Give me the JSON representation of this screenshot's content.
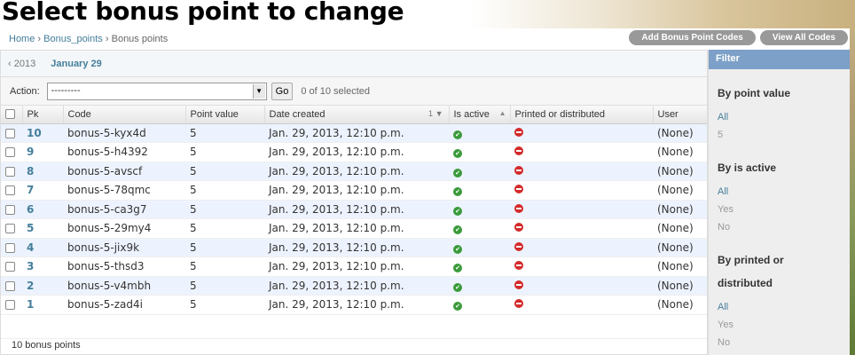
{
  "page": {
    "title": "Select bonus point to change"
  },
  "breadcrumb": {
    "home": "Home",
    "app": "Bonus_points",
    "current": "Bonus points",
    "sep": "›"
  },
  "tools": {
    "add": "Add Bonus Point Codes",
    "view_all": "View All Codes"
  },
  "date_hierarchy": {
    "prev": "‹ 2013",
    "current": "January 29"
  },
  "actions": {
    "label": "Action:",
    "select_value": "---------",
    "go": "Go",
    "selected_count": "0 of 10 selected"
  },
  "table": {
    "columns": [
      "Pk",
      "Code",
      "Point value",
      "Date created",
      "Is active",
      "Printed or distributed",
      "User"
    ],
    "sort_index": "1",
    "rows": [
      {
        "pk": "10",
        "code": "bonus-5-kyx4d",
        "point_value": "5",
        "date": "Jan. 29, 2013, 12:10 p.m.",
        "active": true,
        "printed": false,
        "user": "(None)"
      },
      {
        "pk": "9",
        "code": "bonus-5-h4392",
        "point_value": "5",
        "date": "Jan. 29, 2013, 12:10 p.m.",
        "active": true,
        "printed": false,
        "user": "(None)"
      },
      {
        "pk": "8",
        "code": "bonus-5-avscf",
        "point_value": "5",
        "date": "Jan. 29, 2013, 12:10 p.m.",
        "active": true,
        "printed": false,
        "user": "(None)"
      },
      {
        "pk": "7",
        "code": "bonus-5-78qmc",
        "point_value": "5",
        "date": "Jan. 29, 2013, 12:10 p.m.",
        "active": true,
        "printed": false,
        "user": "(None)"
      },
      {
        "pk": "6",
        "code": "bonus-5-ca3g7",
        "point_value": "5",
        "date": "Jan. 29, 2013, 12:10 p.m.",
        "active": true,
        "printed": false,
        "user": "(None)"
      },
      {
        "pk": "5",
        "code": "bonus-5-29my4",
        "point_value": "5",
        "date": "Jan. 29, 2013, 12:10 p.m.",
        "active": true,
        "printed": false,
        "user": "(None)"
      },
      {
        "pk": "4",
        "code": "bonus-5-jix9k",
        "point_value": "5",
        "date": "Jan. 29, 2013, 12:10 p.m.",
        "active": true,
        "printed": false,
        "user": "(None)"
      },
      {
        "pk": "3",
        "code": "bonus-5-thsd3",
        "point_value": "5",
        "date": "Jan. 29, 2013, 12:10 p.m.",
        "active": true,
        "printed": false,
        "user": "(None)"
      },
      {
        "pk": "2",
        "code": "bonus-5-v4mbh",
        "point_value": "5",
        "date": "Jan. 29, 2013, 12:10 p.m.",
        "active": true,
        "printed": false,
        "user": "(None)"
      },
      {
        "pk": "1",
        "code": "bonus-5-zad4i",
        "point_value": "5",
        "date": "Jan. 29, 2013, 12:10 p.m.",
        "active": true,
        "printed": false,
        "user": "(None)"
      }
    ]
  },
  "paginator": {
    "text": "10 bonus points"
  },
  "filter": {
    "title": "Filter",
    "groups": [
      {
        "heading": "By point value",
        "options": [
          {
            "label": "All",
            "selected": true
          },
          {
            "label": "5",
            "selected": false
          }
        ]
      },
      {
        "heading": "By is active",
        "options": [
          {
            "label": "All",
            "selected": true
          },
          {
            "label": "Yes",
            "selected": false
          },
          {
            "label": "No",
            "selected": false
          }
        ]
      },
      {
        "heading": "By printed or distributed",
        "options": [
          {
            "label": "All",
            "selected": true
          },
          {
            "label": "Yes",
            "selected": false
          },
          {
            "label": "No",
            "selected": false
          }
        ]
      }
    ]
  },
  "colors": {
    "link": "#447e9b",
    "filter_header": "#7ca0c7",
    "yes": "#3a9b3a",
    "no": "#d42a2a"
  },
  "icons": {
    "yes": "check-circle-icon",
    "no": "minus-circle-icon"
  }
}
